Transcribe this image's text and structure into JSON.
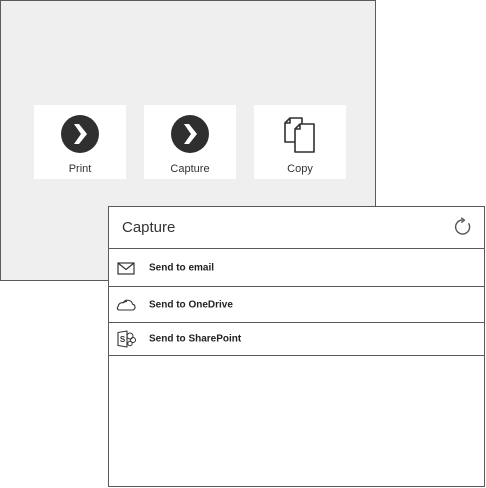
{
  "launcher": {
    "tiles": [
      {
        "label": "Print",
        "icon": "print-icon"
      },
      {
        "label": "Capture",
        "icon": "capture-icon"
      },
      {
        "label": "Copy",
        "icon": "copy-icon"
      }
    ]
  },
  "capture_panel": {
    "title": "Capture",
    "refresh_icon": "refresh-icon",
    "actions": [
      {
        "label": "Send to email",
        "icon": "envelope-icon"
      },
      {
        "label": "Send to OneDrive",
        "icon": "onedrive-cloud-icon"
      },
      {
        "label": "Send to SharePoint",
        "icon": "sharepoint-icon"
      }
    ]
  },
  "colors": {
    "launcher_background": "#efefef",
    "tile_background": "#ffffff",
    "icon_dark": "#2f2f2f",
    "border": "#5a5a5a"
  }
}
